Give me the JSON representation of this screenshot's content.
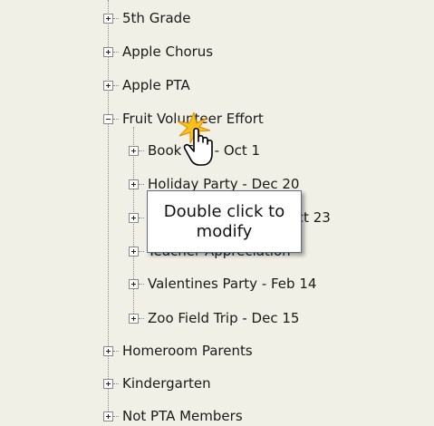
{
  "tree": {
    "items": [
      {
        "label": "5th Grade",
        "state": "collapsed"
      },
      {
        "label": "Apple Chorus",
        "state": "collapsed"
      },
      {
        "label": "Apple PTA",
        "state": "collapsed"
      },
      {
        "label": "Fruit Volunteer Effort",
        "state": "expanded",
        "children": [
          {
            "label": "Book Fair - Oct 1",
            "state": "collapsed"
          },
          {
            "label": "Holiday Party - Dec 20",
            "state": "collapsed"
          },
          {
            "label": "Oct 23",
            "state": "collapsed"
          },
          {
            "label": "Teacher Appreciation",
            "state": "collapsed"
          },
          {
            "label": "Valentines Party - Feb 14",
            "state": "collapsed"
          },
          {
            "label": "Zoo Field Trip - Dec 15",
            "state": "collapsed"
          }
        ]
      },
      {
        "label": "Homeroom Parents",
        "state": "collapsed"
      },
      {
        "label": "Kindergarten",
        "state": "collapsed"
      },
      {
        "label": "Not PTA Members",
        "state": "collapsed"
      }
    ]
  },
  "tooltip": {
    "text": "Double click to modify"
  },
  "cursor": {
    "icon": "hand-pointer-icon",
    "effect": "click-spark"
  }
}
